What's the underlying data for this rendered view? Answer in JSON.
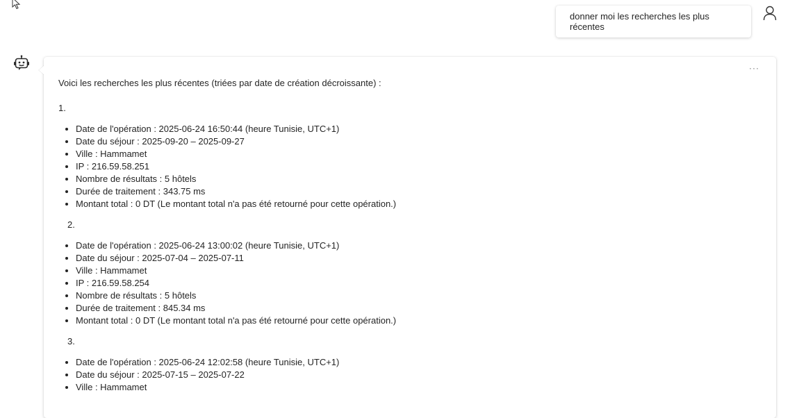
{
  "user_message": {
    "text": "donner moi les recherches les plus récentes"
  },
  "bot_message": {
    "intro": "Voici les recherches les plus récentes (triées par date de création décroissante) :",
    "more_label": "···",
    "items": [
      {
        "number": "1.",
        "details": [
          "Date de l'opération : 2025-06-24 16:50:44 (heure Tunisie, UTC+1)",
          "Date du séjour : 2025-09-20 – 2025-09-27",
          "Ville : Hammamet",
          "IP : 216.59.58.251",
          "Nombre de résultats : 5 hôtels",
          "Durée de traitement : 343.75 ms",
          "Montant total : 0 DT (Le montant total n'a pas été retourné pour cette opération.)"
        ]
      },
      {
        "number": "2.",
        "details": [
          "Date de l'opération : 2025-06-24 13:00:02 (heure Tunisie, UTC+1)",
          "Date du séjour : 2025-07-04 – 2025-07-11",
          "Ville : Hammamet",
          "IP : 216.59.58.254",
          "Nombre de résultats : 5 hôtels",
          "Durée de traitement : 845.34 ms",
          "Montant total : 0 DT (Le montant total n'a pas été retourné pour cette opération.)"
        ]
      },
      {
        "number": "3.",
        "details": [
          "Date de l'opération : 2025-06-24 12:02:58 (heure Tunisie, UTC+1)",
          "Date du séjour : 2025-07-15 – 2025-07-22",
          "Ville : Hammamet"
        ]
      }
    ]
  },
  "icons": {
    "cursor": "mouse-pointer-icon",
    "user": "person-icon",
    "bot": "robot-icon",
    "more": "more-options-icon"
  }
}
